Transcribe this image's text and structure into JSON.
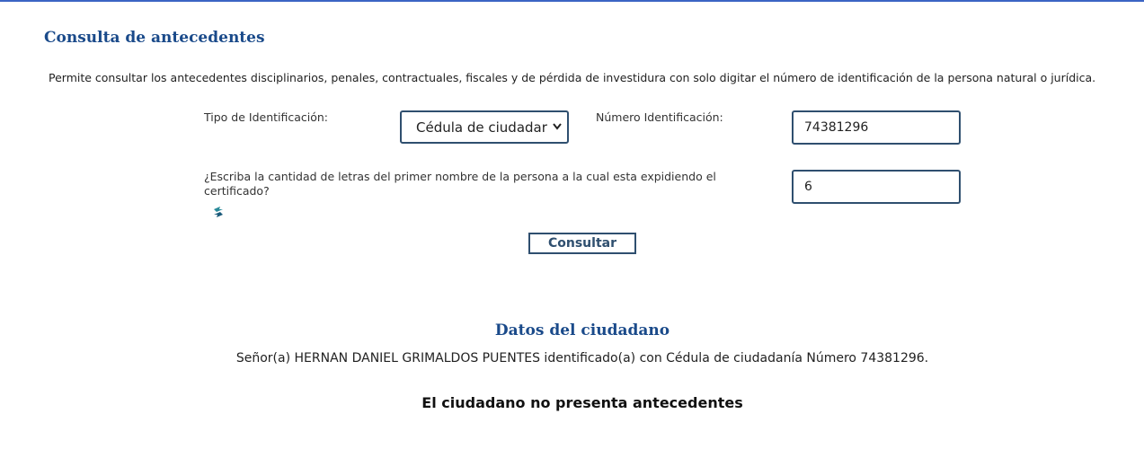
{
  "page": {
    "title": "Consulta de antecedentes",
    "description": "Permite consultar los antecedentes disciplinarios, penales, contractuales, fiscales y de pérdida de investidura con solo digitar el número de identificación de la persona natural o jurídica."
  },
  "form": {
    "tipo_label": "Tipo de Identificación:",
    "tipo_selected": "Cédula de ciudadar",
    "numero_label": "Número Identificación:",
    "numero_value": "74381296",
    "question_label": "¿Escriba la cantidad de letras del primer nombre de la persona a la cual esta expidiendo el certificado?",
    "letras_value": "6",
    "refresh_icon": "refresh-icon",
    "submit_label": "Consultar"
  },
  "result": {
    "section_title": "Datos del ciudadano",
    "citizen_text": "Señor(a)  HERNAN DANIEL GRIMALDOS PUENTES identificado(a) con Cédula de ciudadanía Número 74381296.",
    "status_text": "El ciudadano no presenta antecedentes"
  },
  "colors": {
    "heading": "#1a4a8a",
    "border": "#2f4f6f",
    "top_line": "#3b64c4"
  }
}
